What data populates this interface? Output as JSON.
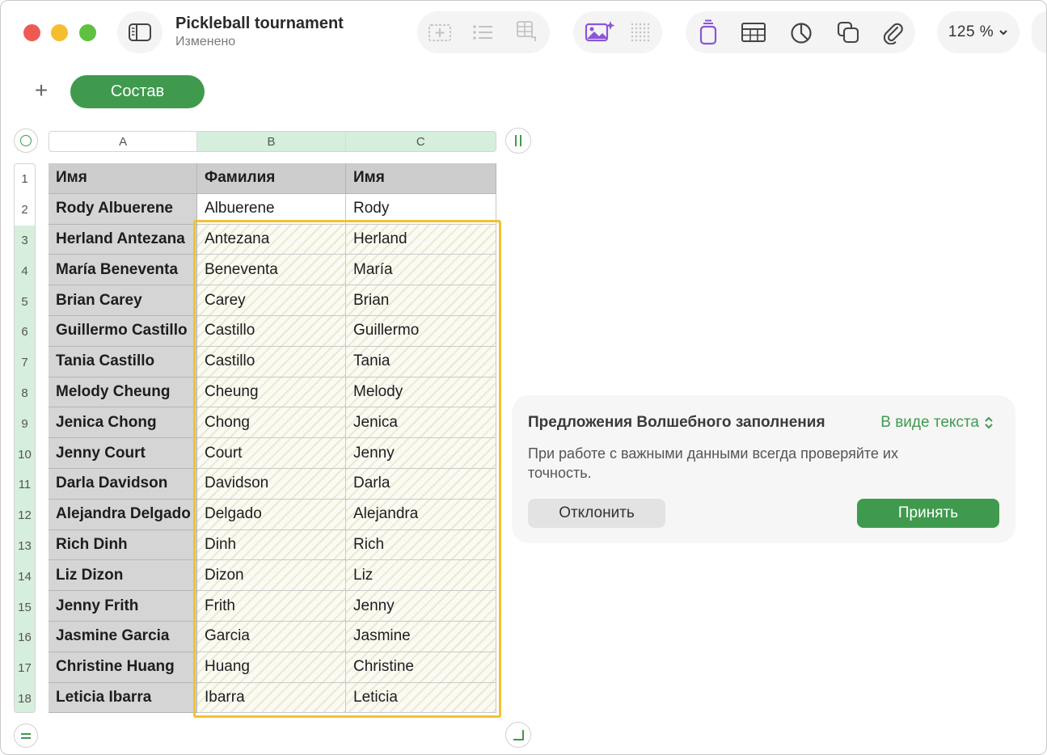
{
  "window": {
    "title": "Pickleball tournament",
    "status": "Изменено"
  },
  "toolbar": {
    "zoom": "125 %",
    "accent_color": "#3f9a4e",
    "icons": [
      "sidebar-icon",
      "add-text-box-icon",
      "list-icon",
      "table-add-icon",
      "ai-image-icon",
      "dotted-grid-icon",
      "format-icon",
      "table-icon",
      "chart-icon",
      "shapes-icon",
      "attachment-icon"
    ]
  },
  "sheets": {
    "active": "Состав"
  },
  "table": {
    "columns": [
      "A",
      "B",
      "C"
    ],
    "header": [
      "Имя",
      "Фамилия",
      "Имя"
    ],
    "rows": [
      [
        "Rody Albuerene",
        "Albuerene",
        "Rody"
      ],
      [
        "Herland Antezana",
        "Antezana",
        "Herland"
      ],
      [
        "María Beneventa",
        "Beneventa",
        "María"
      ],
      [
        "Brian Carey",
        "Carey",
        "Brian"
      ],
      [
        "Guillermo Castillo",
        "Castillo",
        "Guillermo"
      ],
      [
        "Tania Castillo",
        "Castillo",
        "Tania"
      ],
      [
        "Melody Cheung",
        "Cheung",
        "Melody"
      ],
      [
        "Jenica Chong",
        "Chong",
        "Jenica"
      ],
      [
        "Jenny Court",
        "Court",
        "Jenny"
      ],
      [
        "Darla Davidson",
        "Davidson",
        "Darla"
      ],
      [
        "Alejandra Delgado",
        "Delgado",
        "Alejandra"
      ],
      [
        "Rich Dinh",
        "Dinh",
        "Rich"
      ],
      [
        "Liz Dizon",
        "Dizon",
        "Liz"
      ],
      [
        "Jenny Frith",
        "Frith",
        "Jenny"
      ],
      [
        "Jasmine Garcia",
        "Garcia",
        "Jasmine"
      ],
      [
        "Christine Huang",
        "Huang",
        "Christine"
      ],
      [
        "Leticia Ibarra",
        "Ibarra",
        "Leticia"
      ]
    ]
  },
  "popover": {
    "title": "Предложения Волшебного заполнения",
    "mode": "В виде текста",
    "message": "При работе с важными данными всегда проверяйте их точность.",
    "decline": "Отклонить",
    "accept": "Принять"
  }
}
